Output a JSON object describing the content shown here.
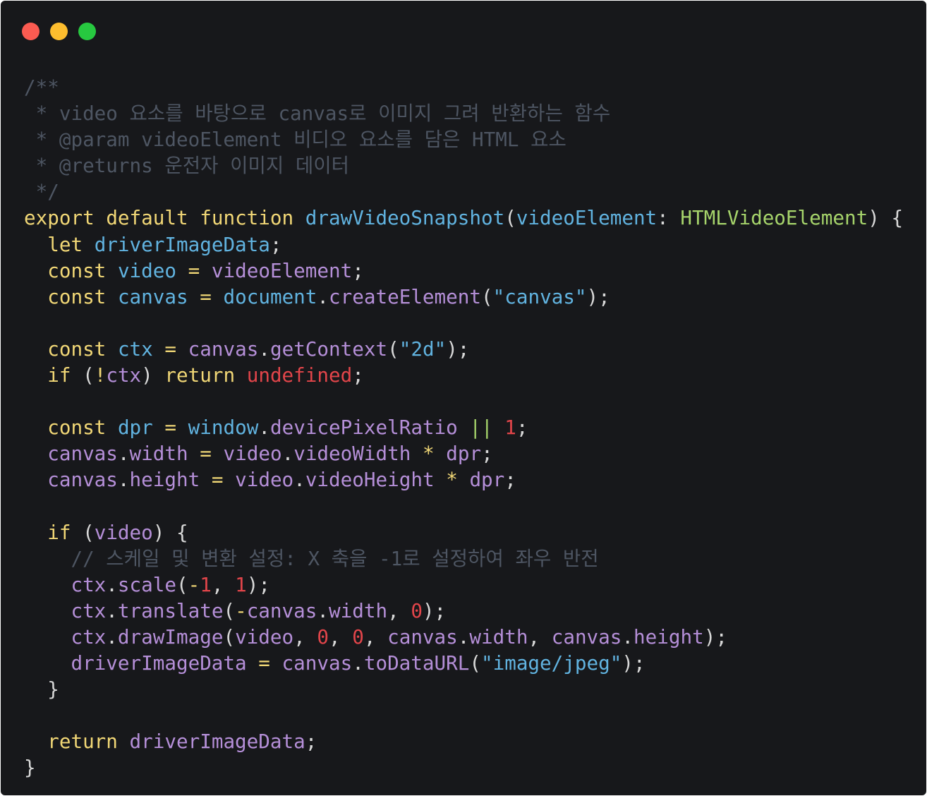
{
  "window": {
    "controls": [
      {
        "name": "close",
        "color": "#fb5b51"
      },
      {
        "name": "minimize",
        "color": "#fdbd2e"
      },
      {
        "name": "maximize",
        "color": "#27c840"
      }
    ]
  },
  "code": {
    "language": "typescript",
    "lines": [
      [
        {
          "t": "/**",
          "c": "comment"
        }
      ],
      [
        {
          "t": " * video 요소를 바탕으로 canvas로 이미지 그려 반환하는 함수",
          "c": "comment"
        }
      ],
      [
        {
          "t": " * @param videoElement 비디오 요소를 담은 HTML 요소",
          "c": "comment"
        }
      ],
      [
        {
          "t": " * @returns 운전자 이미지 데이터",
          "c": "comment"
        }
      ],
      [
        {
          "t": " */",
          "c": "comment"
        }
      ],
      [
        {
          "t": "export",
          "c": "keyword"
        },
        {
          "t": " ",
          "c": "plain"
        },
        {
          "t": "default",
          "c": "keyword"
        },
        {
          "t": " ",
          "c": "plain"
        },
        {
          "t": "function",
          "c": "keyword"
        },
        {
          "t": " ",
          "c": "plain"
        },
        {
          "t": "drawVideoSnapshot",
          "c": "func"
        },
        {
          "t": "(",
          "c": "punct"
        },
        {
          "t": "videoElement",
          "c": "var"
        },
        {
          "t": ": ",
          "c": "punct"
        },
        {
          "t": "HTMLVideoElement",
          "c": "type"
        },
        {
          "t": ") {",
          "c": "punct"
        }
      ],
      [
        {
          "t": "  ",
          "c": "plain"
        },
        {
          "t": "let",
          "c": "keyword"
        },
        {
          "t": " ",
          "c": "plain"
        },
        {
          "t": "driverImageData",
          "c": "var"
        },
        {
          "t": ";",
          "c": "punct"
        }
      ],
      [
        {
          "t": "  ",
          "c": "plain"
        },
        {
          "t": "const",
          "c": "keyword"
        },
        {
          "t": " ",
          "c": "plain"
        },
        {
          "t": "video",
          "c": "var"
        },
        {
          "t": " ",
          "c": "plain"
        },
        {
          "t": "=",
          "c": "op"
        },
        {
          "t": " ",
          "c": "plain"
        },
        {
          "t": "videoElement",
          "c": "prop"
        },
        {
          "t": ";",
          "c": "punct"
        }
      ],
      [
        {
          "t": "  ",
          "c": "plain"
        },
        {
          "t": "const",
          "c": "keyword"
        },
        {
          "t": " ",
          "c": "plain"
        },
        {
          "t": "canvas",
          "c": "var"
        },
        {
          "t": " ",
          "c": "plain"
        },
        {
          "t": "=",
          "c": "op"
        },
        {
          "t": " ",
          "c": "plain"
        },
        {
          "t": "document",
          "c": "var"
        },
        {
          "t": ".",
          "c": "punct"
        },
        {
          "t": "createElement",
          "c": "fn2"
        },
        {
          "t": "(",
          "c": "punct"
        },
        {
          "t": "\"canvas\"",
          "c": "string"
        },
        {
          "t": ");",
          "c": "punct"
        }
      ],
      [],
      [
        {
          "t": "  ",
          "c": "plain"
        },
        {
          "t": "const",
          "c": "keyword"
        },
        {
          "t": " ",
          "c": "plain"
        },
        {
          "t": "ctx",
          "c": "var"
        },
        {
          "t": " ",
          "c": "plain"
        },
        {
          "t": "=",
          "c": "op"
        },
        {
          "t": " ",
          "c": "plain"
        },
        {
          "t": "canvas",
          "c": "prop"
        },
        {
          "t": ".",
          "c": "punct"
        },
        {
          "t": "getContext",
          "c": "fn2"
        },
        {
          "t": "(",
          "c": "punct"
        },
        {
          "t": "\"2d\"",
          "c": "string"
        },
        {
          "t": ");",
          "c": "punct"
        }
      ],
      [
        {
          "t": "  ",
          "c": "plain"
        },
        {
          "t": "if",
          "c": "keyword"
        },
        {
          "t": " (",
          "c": "punct"
        },
        {
          "t": "!",
          "c": "op"
        },
        {
          "t": "ctx",
          "c": "prop"
        },
        {
          "t": ") ",
          "c": "punct"
        },
        {
          "t": "return",
          "c": "keyword"
        },
        {
          "t": " ",
          "c": "plain"
        },
        {
          "t": "undefined",
          "c": "undef"
        },
        {
          "t": ";",
          "c": "punct"
        }
      ],
      [],
      [
        {
          "t": "  ",
          "c": "plain"
        },
        {
          "t": "const",
          "c": "keyword"
        },
        {
          "t": " ",
          "c": "plain"
        },
        {
          "t": "dpr",
          "c": "var"
        },
        {
          "t": " ",
          "c": "plain"
        },
        {
          "t": "=",
          "c": "op"
        },
        {
          "t": " ",
          "c": "plain"
        },
        {
          "t": "window",
          "c": "var"
        },
        {
          "t": ".",
          "c": "punct"
        },
        {
          "t": "devicePixelRatio",
          "c": "prop"
        },
        {
          "t": " ",
          "c": "plain"
        },
        {
          "t": "||",
          "c": "type"
        },
        {
          "t": " ",
          "c": "plain"
        },
        {
          "t": "1",
          "c": "number"
        },
        {
          "t": ";",
          "c": "punct"
        }
      ],
      [
        {
          "t": "  ",
          "c": "plain"
        },
        {
          "t": "canvas",
          "c": "prop"
        },
        {
          "t": ".",
          "c": "punct"
        },
        {
          "t": "width",
          "c": "prop"
        },
        {
          "t": " ",
          "c": "plain"
        },
        {
          "t": "=",
          "c": "op"
        },
        {
          "t": " ",
          "c": "plain"
        },
        {
          "t": "video",
          "c": "prop"
        },
        {
          "t": ".",
          "c": "punct"
        },
        {
          "t": "videoWidth",
          "c": "prop"
        },
        {
          "t": " ",
          "c": "plain"
        },
        {
          "t": "*",
          "c": "op"
        },
        {
          "t": " ",
          "c": "plain"
        },
        {
          "t": "dpr",
          "c": "prop"
        },
        {
          "t": ";",
          "c": "punct"
        }
      ],
      [
        {
          "t": "  ",
          "c": "plain"
        },
        {
          "t": "canvas",
          "c": "prop"
        },
        {
          "t": ".",
          "c": "punct"
        },
        {
          "t": "height",
          "c": "prop"
        },
        {
          "t": " ",
          "c": "plain"
        },
        {
          "t": "=",
          "c": "op"
        },
        {
          "t": " ",
          "c": "plain"
        },
        {
          "t": "video",
          "c": "prop"
        },
        {
          "t": ".",
          "c": "punct"
        },
        {
          "t": "videoHeight",
          "c": "prop"
        },
        {
          "t": " ",
          "c": "plain"
        },
        {
          "t": "*",
          "c": "op"
        },
        {
          "t": " ",
          "c": "plain"
        },
        {
          "t": "dpr",
          "c": "prop"
        },
        {
          "t": ";",
          "c": "punct"
        }
      ],
      [],
      [
        {
          "t": "  ",
          "c": "plain"
        },
        {
          "t": "if",
          "c": "keyword"
        },
        {
          "t": " (",
          "c": "punct"
        },
        {
          "t": "video",
          "c": "prop"
        },
        {
          "t": ") {",
          "c": "punct"
        }
      ],
      [
        {
          "t": "    ",
          "c": "plain"
        },
        {
          "t": "// 스케일 및 변환 설정: X 축을 -1로 설정하여 좌우 반전",
          "c": "comment"
        }
      ],
      [
        {
          "t": "    ",
          "c": "plain"
        },
        {
          "t": "ctx",
          "c": "prop"
        },
        {
          "t": ".",
          "c": "punct"
        },
        {
          "t": "scale",
          "c": "fn2"
        },
        {
          "t": "(",
          "c": "punct"
        },
        {
          "t": "-",
          "c": "op"
        },
        {
          "t": "1",
          "c": "number"
        },
        {
          "t": ", ",
          "c": "punct"
        },
        {
          "t": "1",
          "c": "number"
        },
        {
          "t": ");",
          "c": "punct"
        }
      ],
      [
        {
          "t": "    ",
          "c": "plain"
        },
        {
          "t": "ctx",
          "c": "prop"
        },
        {
          "t": ".",
          "c": "punct"
        },
        {
          "t": "translate",
          "c": "fn2"
        },
        {
          "t": "(",
          "c": "punct"
        },
        {
          "t": "-",
          "c": "op"
        },
        {
          "t": "canvas",
          "c": "prop"
        },
        {
          "t": ".",
          "c": "punct"
        },
        {
          "t": "width",
          "c": "prop"
        },
        {
          "t": ", ",
          "c": "punct"
        },
        {
          "t": "0",
          "c": "number"
        },
        {
          "t": ");",
          "c": "punct"
        }
      ],
      [
        {
          "t": "    ",
          "c": "plain"
        },
        {
          "t": "ctx",
          "c": "prop"
        },
        {
          "t": ".",
          "c": "punct"
        },
        {
          "t": "drawImage",
          "c": "fn2"
        },
        {
          "t": "(",
          "c": "punct"
        },
        {
          "t": "video",
          "c": "prop"
        },
        {
          "t": ", ",
          "c": "punct"
        },
        {
          "t": "0",
          "c": "number"
        },
        {
          "t": ", ",
          "c": "punct"
        },
        {
          "t": "0",
          "c": "number"
        },
        {
          "t": ", ",
          "c": "punct"
        },
        {
          "t": "canvas",
          "c": "prop"
        },
        {
          "t": ".",
          "c": "punct"
        },
        {
          "t": "width",
          "c": "prop"
        },
        {
          "t": ", ",
          "c": "punct"
        },
        {
          "t": "canvas",
          "c": "prop"
        },
        {
          "t": ".",
          "c": "punct"
        },
        {
          "t": "height",
          "c": "prop"
        },
        {
          "t": ");",
          "c": "punct"
        }
      ],
      [
        {
          "t": "    ",
          "c": "plain"
        },
        {
          "t": "driverImageData",
          "c": "prop"
        },
        {
          "t": " ",
          "c": "plain"
        },
        {
          "t": "=",
          "c": "op"
        },
        {
          "t": " ",
          "c": "plain"
        },
        {
          "t": "canvas",
          "c": "prop"
        },
        {
          "t": ".",
          "c": "punct"
        },
        {
          "t": "toDataURL",
          "c": "fn2"
        },
        {
          "t": "(",
          "c": "punct"
        },
        {
          "t": "\"image/jpeg\"",
          "c": "string"
        },
        {
          "t": ");",
          "c": "punct"
        }
      ],
      [
        {
          "t": "  }",
          "c": "punct"
        }
      ],
      [],
      [
        {
          "t": "  ",
          "c": "plain"
        },
        {
          "t": "return",
          "c": "keyword"
        },
        {
          "t": " ",
          "c": "plain"
        },
        {
          "t": "driverImageData",
          "c": "prop"
        },
        {
          "t": ";",
          "c": "punct"
        }
      ],
      [
        {
          "t": "}",
          "c": "punct"
        }
      ]
    ]
  }
}
